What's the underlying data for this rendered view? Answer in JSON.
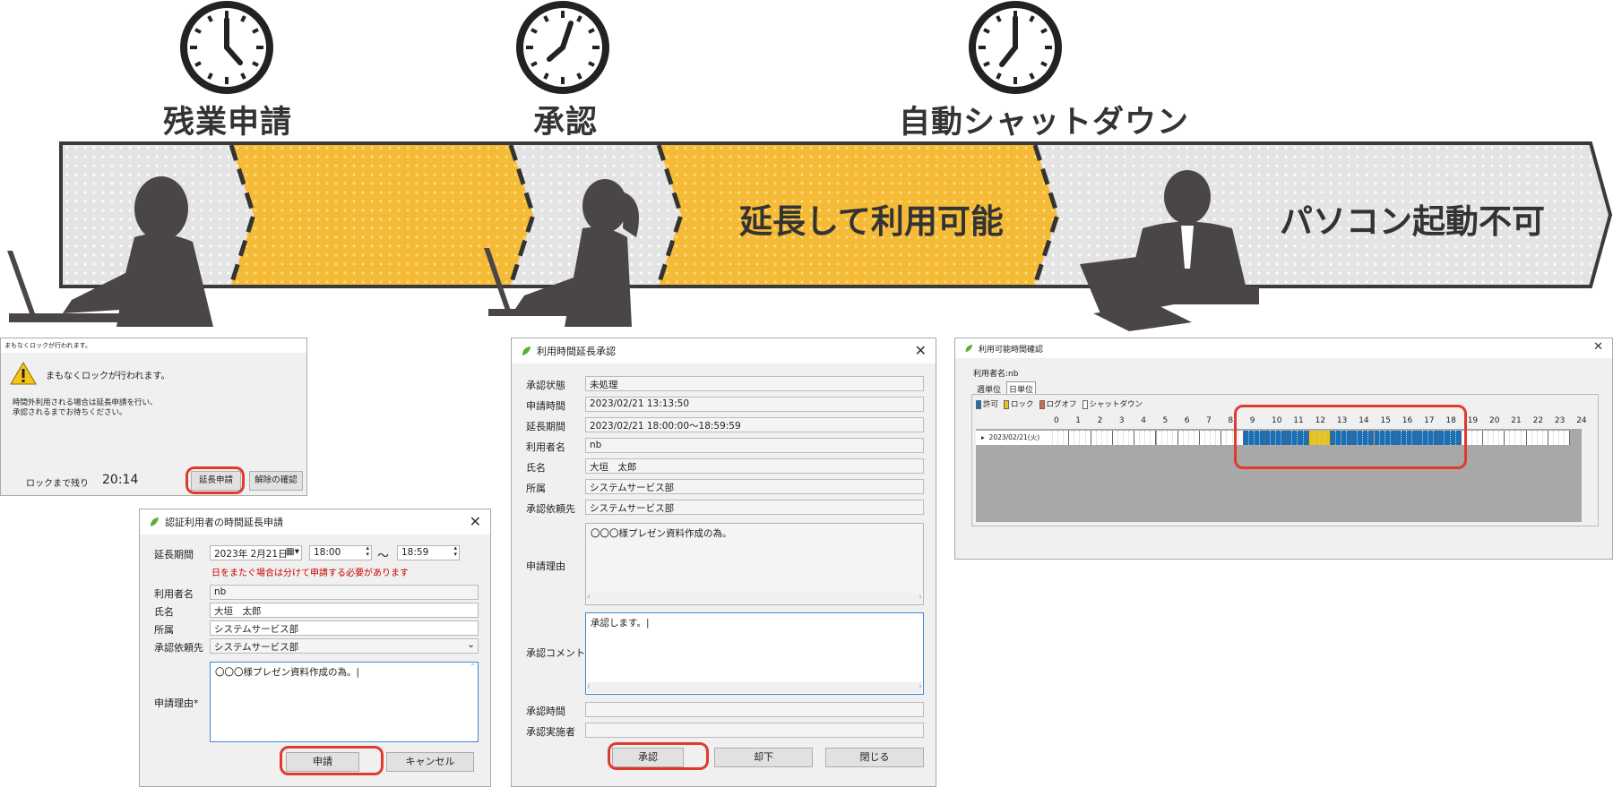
{
  "stages": [
    {
      "label": "残業申請"
    },
    {
      "label": "承認"
    },
    {
      "label": "自動シャットダウン"
    }
  ],
  "band": {
    "extended_text": "延長して利用可能",
    "blocked_text": "パソコン起動不可",
    "colors": {
      "gray": "#e4e4e4",
      "yellow": "#f5bb36",
      "outline": "#3a3a3a",
      "silhouette": "#4a4646"
    }
  },
  "lock_dialog": {
    "title": "まもなくロックが行われます。",
    "message": "まもなくロックが行われます。",
    "note_line1": "時間外利用される場合は延長申請を行い、",
    "note_line2": "承認されるまでお待ちください。",
    "remain_label": "ロックまで残り",
    "remain_value": "20:14",
    "request_button": "延長申請",
    "release_button": "解除の確認"
  },
  "request_dialog": {
    "title": "認証利用者の時間延長申請",
    "period_label": "延長期間",
    "date_value": "2023年 2月21日",
    "time_from": "18:00",
    "tilde": "～",
    "time_to": "18:59",
    "warning": "日をまたぐ場合は分けて申請する必要があります",
    "user_label": "利用者名",
    "user_value": "nb",
    "name_label": "氏名",
    "name_value": "大垣　太郎",
    "dept_label": "所属",
    "dept_value": "システムサービス部",
    "approver_label": "承認依頼先",
    "approver_value": "システムサービス部",
    "reason_label": "申請理由*",
    "reason_value": "〇〇〇様プレゼン資料作成の為。|",
    "submit_button": "申請",
    "cancel_button": "キャンセル"
  },
  "approve_dialog": {
    "title": "利用時間延長承認",
    "fields": [
      {
        "label": "承認状態",
        "value": "未処理"
      },
      {
        "label": "申請時間",
        "value": "2023/02/21 13:13:50"
      },
      {
        "label": "延長期間",
        "value": "2023/02/21 18:00:00～18:59:59"
      },
      {
        "label": "利用者名",
        "value": "nb"
      },
      {
        "label": "氏名",
        "value": "大垣　太郎"
      },
      {
        "label": "所属",
        "value": "システムサービス部"
      },
      {
        "label": "承認依頼先",
        "value": "システムサービス部"
      }
    ],
    "reason_label": "申請理由",
    "reason_value": "〇〇〇様プレゼン資料作成の為。",
    "comment_label": "承認コメント",
    "comment_value": "承認します。|",
    "time_label": "承認時間",
    "executor_label": "承認実施者",
    "approve_button": "承認",
    "reject_button": "却下",
    "close_button": "閉じる"
  },
  "schedule_dialog": {
    "title": "利用可能時間確認",
    "user_line": "利用者名:nb",
    "tab_week": "週単位",
    "tab_day": "日単位",
    "legend": [
      {
        "label": "許可",
        "color": "#1a6fb5"
      },
      {
        "label": "ロック",
        "color": "#e8c21a"
      },
      {
        "label": "ログオフ",
        "color": "#d86a4a"
      },
      {
        "label": "シャットダウン",
        "color": "#ffffff"
      }
    ],
    "hours": [
      "0",
      "1",
      "2",
      "3",
      "4",
      "5",
      "6",
      "7",
      "8",
      "9",
      "10",
      "11",
      "12",
      "13",
      "14",
      "15",
      "16",
      "17",
      "18",
      "19",
      "20",
      "21",
      "22",
      "23",
      "24"
    ],
    "row_date": "2023/02/21(火)",
    "allowed_hours": [
      9,
      19
    ],
    "lock_hours": [
      12,
      13
    ]
  }
}
